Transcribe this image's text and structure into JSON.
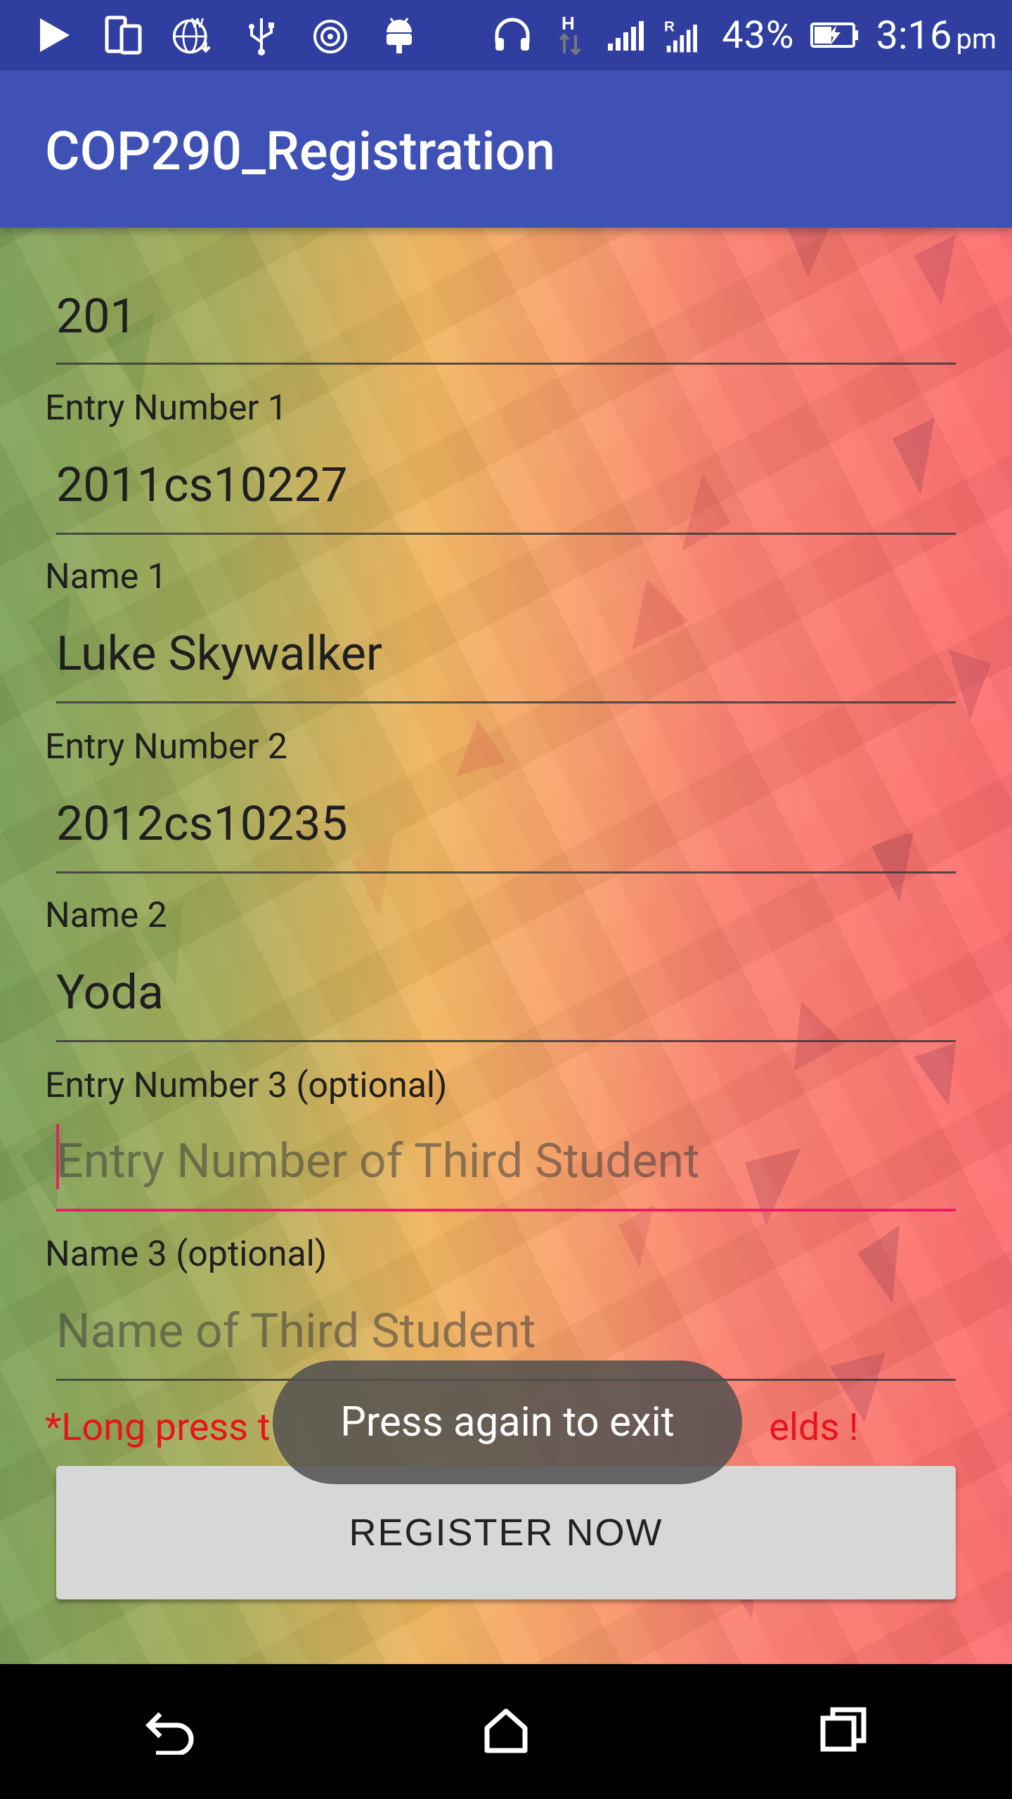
{
  "status_bar": {
    "battery": "43%",
    "time": "3:16",
    "ampm": "pm",
    "icons": [
      "play-icon",
      "dual-screen-icon",
      "wifi-globe-icon",
      "usb-icon",
      "target-icon",
      "android-icon",
      "headphones-icon",
      "h-data-icon",
      "signal-icon",
      "roaming-signal-icon",
      "battery-charging-icon"
    ]
  },
  "app_bar": {
    "title": "COP290_Registration"
  },
  "form": {
    "team_value": "201",
    "entry1": {
      "label": "Entry Number 1",
      "value": "2011cs10227"
    },
    "name1": {
      "label": "Name 1",
      "value": "Luke Skywalker"
    },
    "entry2": {
      "label": "Entry Number 2",
      "value": "2012cs10235"
    },
    "name2": {
      "label": "Name 2",
      "value": "Yoda"
    },
    "entry3": {
      "label": "Entry Number 3 (optional)",
      "placeholder": "Entry Number of Third Student"
    },
    "name3": {
      "label": "Name 3 (optional)",
      "placeholder": "Name of Third Student"
    },
    "hint_left": "*Long press t",
    "hint_right": "elds !",
    "register_label": "REGISTER NOW"
  },
  "toast": {
    "text": "Press again to exit"
  },
  "nav": {
    "icons": [
      "back-icon",
      "home-icon",
      "recents-icon"
    ]
  },
  "colors": {
    "status_bar": "#303f9f",
    "app_bar": "#3f51b5",
    "accent": "#e91e63",
    "hint": "#e8141b"
  }
}
